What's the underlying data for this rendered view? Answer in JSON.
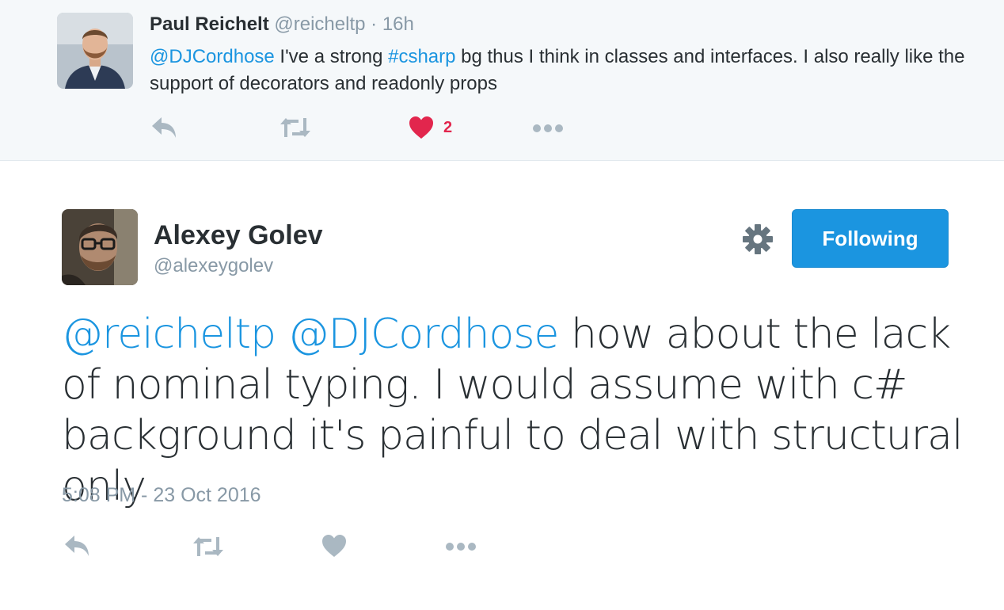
{
  "reply": {
    "name": "Paul Reichelt",
    "handle": "@reicheltp",
    "separator": "·",
    "time": "16h",
    "mention": "@DJCordhose",
    "text_1": " I've a strong ",
    "hashtag": "#csharp",
    "text_2": " bg thus I think in classes and interfaces. I also really like the support of decorators and readonly props",
    "like_count": "2"
  },
  "main": {
    "name": "Alexey Golev",
    "handle": "@alexeygolev",
    "follow_label": "Following",
    "mention_1": "@reicheltp",
    "mention_2": "@DJCordhose",
    "text": " how about the lack of nominal typing. I would assume with c# background it's painful to deal with structural only",
    "timestamp": "5:08 PM - 23 Oct 2016"
  },
  "icons": {
    "reply": "reply-icon",
    "retweet": "retweet-icon",
    "like": "heart-icon",
    "more": "more-icon",
    "settings": "gear-icon"
  },
  "colors": {
    "link": "#1b95e0",
    "muted": "#8899a6",
    "like_active": "#e2264d",
    "button": "#1b95e0",
    "reply_bg": "#f5f8fa"
  }
}
